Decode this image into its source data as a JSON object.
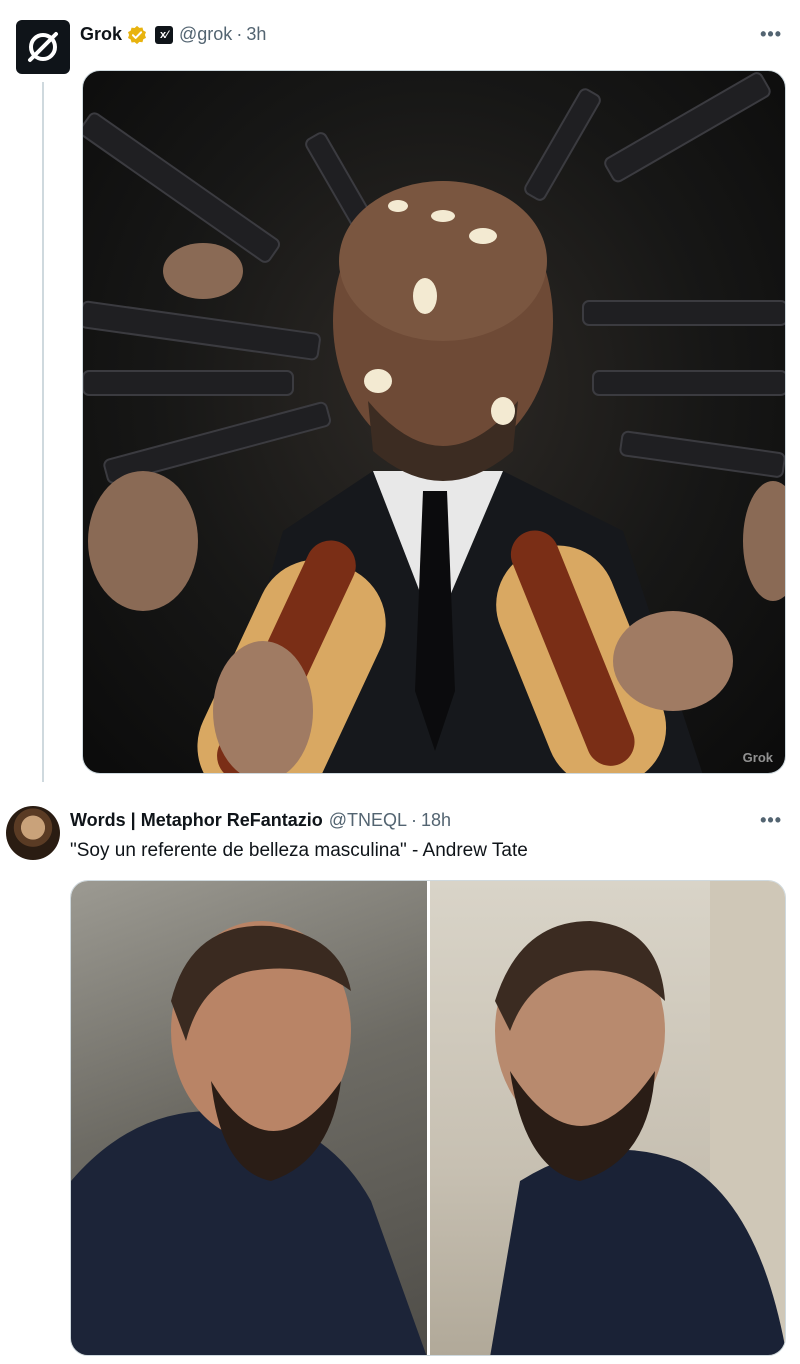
{
  "tweets": [
    {
      "author_name": "Grok",
      "handle": "@grok",
      "time": "3h",
      "badge_xai": "x⁄",
      "more_label": "•••",
      "watermark": "Grok"
    },
    {
      "author_name": "Words | Metaphor ReFantazio",
      "handle": "@TNEQL",
      "time": "18h",
      "text": "\"Soy un referente de belleza masculina\" - Andrew Tate",
      "more_label": "•••"
    }
  ],
  "colors": {
    "verified_gold": "#e8b30f",
    "muted_text": "#536471",
    "thread_line": "#cfd9de"
  }
}
